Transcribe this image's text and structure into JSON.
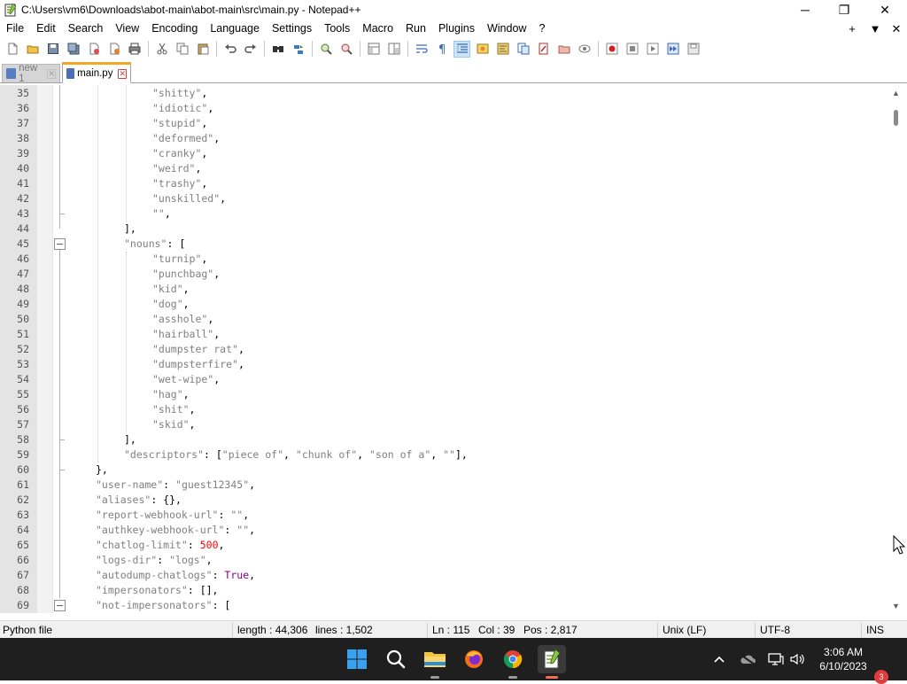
{
  "window": {
    "title": "C:\\Users\\vm6\\Downloads\\abot-main\\abot-main\\src\\main.py - Notepad++",
    "minimize": "─",
    "maximize": "❐",
    "close": "✕"
  },
  "menu": {
    "items": [
      "File",
      "Edit",
      "Search",
      "View",
      "Encoding",
      "Language",
      "Settings",
      "Tools",
      "Macro",
      "Run",
      "Plugins",
      "Window",
      "?"
    ],
    "right_controls": [
      "+",
      "▼",
      "✕"
    ]
  },
  "toolbar": {
    "icons": [
      "new-file-icon",
      "open-file-icon",
      "save-icon",
      "save-all-icon",
      "close-icon",
      "close-all-icon",
      "print-icon",
      "cut-icon",
      "copy-icon",
      "paste-icon",
      "undo-icon",
      "redo-icon",
      "find-icon",
      "replace-icon",
      "zoom-in-icon",
      "zoom-out-icon",
      "sync-vertical-icon",
      "sync-horizontal-icon",
      "word-wrap-icon",
      "show-all-chars-icon",
      "indent-guide-icon",
      "user-language-icon",
      "document-map-icon",
      "function-list-icon",
      "folder-workspace-icon",
      "doc-list-icon",
      "monitoring-icon",
      "record-macro-icon",
      "stop-macro-icon",
      "play-macro-icon",
      "run-macro-multiple-icon",
      "save-macro-icon"
    ]
  },
  "tabs": [
    {
      "label": "new 1",
      "active": false
    },
    {
      "label": "main.py",
      "active": true
    }
  ],
  "editor": {
    "lines": [
      {
        "num": "35",
        "tokens": [
          [
            "s",
            "\"shitty\""
          ],
          [
            "p",
            ","
          ]
        ]
      },
      {
        "num": "36",
        "tokens": [
          [
            "s",
            "\"idiotic\""
          ],
          [
            "p",
            ","
          ]
        ]
      },
      {
        "num": "37",
        "tokens": [
          [
            "s",
            "\"stupid\""
          ],
          [
            "p",
            ","
          ]
        ]
      },
      {
        "num": "38",
        "tokens": [
          [
            "s",
            "\"deformed\""
          ],
          [
            "p",
            ","
          ]
        ]
      },
      {
        "num": "39",
        "tokens": [
          [
            "s",
            "\"cranky\""
          ],
          [
            "p",
            ","
          ]
        ]
      },
      {
        "num": "40",
        "tokens": [
          [
            "s",
            "\"weird\""
          ],
          [
            "p",
            ","
          ]
        ]
      },
      {
        "num": "41",
        "tokens": [
          [
            "s",
            "\"trashy\""
          ],
          [
            "p",
            ","
          ]
        ]
      },
      {
        "num": "42",
        "tokens": [
          [
            "s",
            "\"unskilled\""
          ],
          [
            "p",
            ","
          ]
        ]
      },
      {
        "num": "43",
        "tokens": [
          [
            "s",
            "\"\""
          ],
          [
            "p",
            ","
          ]
        ]
      },
      {
        "num": "44",
        "tokens": [
          [
            "p",
            "],"
          ]
        ]
      },
      {
        "num": "45",
        "tokens": [
          [
            "s",
            "\"nouns\""
          ],
          [
            "p",
            ": ["
          ]
        ]
      },
      {
        "num": "46",
        "tokens": [
          [
            "s",
            "\"turnip\""
          ],
          [
            "p",
            ","
          ]
        ]
      },
      {
        "num": "47",
        "tokens": [
          [
            "s",
            "\"punchbag\""
          ],
          [
            "p",
            ","
          ]
        ]
      },
      {
        "num": "48",
        "tokens": [
          [
            "s",
            "\"kid\""
          ],
          [
            "p",
            ","
          ]
        ]
      },
      {
        "num": "49",
        "tokens": [
          [
            "s",
            "\"dog\""
          ],
          [
            "p",
            ","
          ]
        ]
      },
      {
        "num": "50",
        "tokens": [
          [
            "s",
            "\"asshole\""
          ],
          [
            "p",
            ","
          ]
        ]
      },
      {
        "num": "51",
        "tokens": [
          [
            "s",
            "\"hairball\""
          ],
          [
            "p",
            ","
          ]
        ]
      },
      {
        "num": "52",
        "tokens": [
          [
            "s",
            "\"dumpster rat\""
          ],
          [
            "p",
            ","
          ]
        ]
      },
      {
        "num": "53",
        "tokens": [
          [
            "s",
            "\"dumpsterfire\""
          ],
          [
            "p",
            ","
          ]
        ]
      },
      {
        "num": "54",
        "tokens": [
          [
            "s",
            "\"wet-wipe\""
          ],
          [
            "p",
            ","
          ]
        ]
      },
      {
        "num": "55",
        "tokens": [
          [
            "s",
            "\"hag\""
          ],
          [
            "p",
            ","
          ]
        ]
      },
      {
        "num": "56",
        "tokens": [
          [
            "s",
            "\"shit\""
          ],
          [
            "p",
            ","
          ]
        ]
      },
      {
        "num": "57",
        "tokens": [
          [
            "s",
            "\"skid\""
          ],
          [
            "p",
            ","
          ]
        ]
      },
      {
        "num": "58",
        "tokens": [
          [
            "p",
            "],"
          ]
        ]
      },
      {
        "num": "59",
        "tokens": [
          [
            "s",
            "\"descriptors\""
          ],
          [
            "p",
            ": ["
          ],
          [
            "s",
            "\"piece of\""
          ],
          [
            "p",
            ", "
          ],
          [
            "s",
            "\"chunk of\""
          ],
          [
            "p",
            ", "
          ],
          [
            "s",
            "\"son of a\""
          ],
          [
            "p",
            ", "
          ],
          [
            "s",
            "\"\""
          ],
          [
            "p",
            "],"
          ]
        ]
      },
      {
        "num": "60",
        "tokens": [
          [
            "p",
            "},"
          ]
        ]
      },
      {
        "num": "61",
        "tokens": [
          [
            "s",
            "\"user-name\""
          ],
          [
            "p",
            ": "
          ],
          [
            "s",
            "\"guest12345\""
          ],
          [
            "p",
            ","
          ]
        ]
      },
      {
        "num": "62",
        "tokens": [
          [
            "s",
            "\"aliases\""
          ],
          [
            "p",
            ": {},"
          ]
        ]
      },
      {
        "num": "63",
        "tokens": [
          [
            "s",
            "\"report-webhook-url\""
          ],
          [
            "p",
            ": "
          ],
          [
            "s",
            "\"\""
          ],
          [
            "p",
            ","
          ]
        ]
      },
      {
        "num": "64",
        "tokens": [
          [
            "s",
            "\"authkey-webhook-url\""
          ],
          [
            "p",
            ": "
          ],
          [
            "s",
            "\"\""
          ],
          [
            "p",
            ","
          ]
        ]
      },
      {
        "num": "65",
        "tokens": [
          [
            "s",
            "\"chatlog-limit\""
          ],
          [
            "p",
            ": "
          ],
          [
            "n",
            "500"
          ],
          [
            "p",
            ","
          ]
        ]
      },
      {
        "num": "66",
        "tokens": [
          [
            "s",
            "\"logs-dir\""
          ],
          [
            "p",
            ": "
          ],
          [
            "s",
            "\"logs\""
          ],
          [
            "p",
            ","
          ]
        ]
      },
      {
        "num": "67",
        "tokens": [
          [
            "s",
            "\"autodump-chatlogs\""
          ],
          [
            "p",
            ": "
          ],
          [
            "k",
            "True"
          ],
          [
            "p",
            ","
          ]
        ]
      },
      {
        "num": "68",
        "tokens": [
          [
            "s",
            "\"impersonators\""
          ],
          [
            "p",
            ": [],"
          ]
        ]
      },
      {
        "num": "69",
        "tokens": [
          [
            "s",
            "\"not-impersonators\""
          ],
          [
            "p",
            ": ["
          ]
        ]
      }
    ]
  },
  "statusbar": {
    "file_type": "Python file",
    "length": "length : 44,306",
    "lines": "lines : 1,502",
    "ln": "Ln : 115",
    "col": "Col : 39",
    "pos": "Pos : 2,817",
    "eol": "Unix (LF)",
    "encoding": "UTF-8",
    "mode": "INS"
  },
  "taskbar": {
    "apps": [
      "start-icon",
      "search-icon",
      "file-explorer-icon",
      "firefox-icon",
      "chrome-icon",
      "notepadpp-icon"
    ],
    "tray": [
      "chevron-up-icon",
      "onedrive-icon",
      "network-icon",
      "volume-icon"
    ],
    "time": "3:06 AM",
    "date": "6/10/2023",
    "notifications": "3"
  }
}
